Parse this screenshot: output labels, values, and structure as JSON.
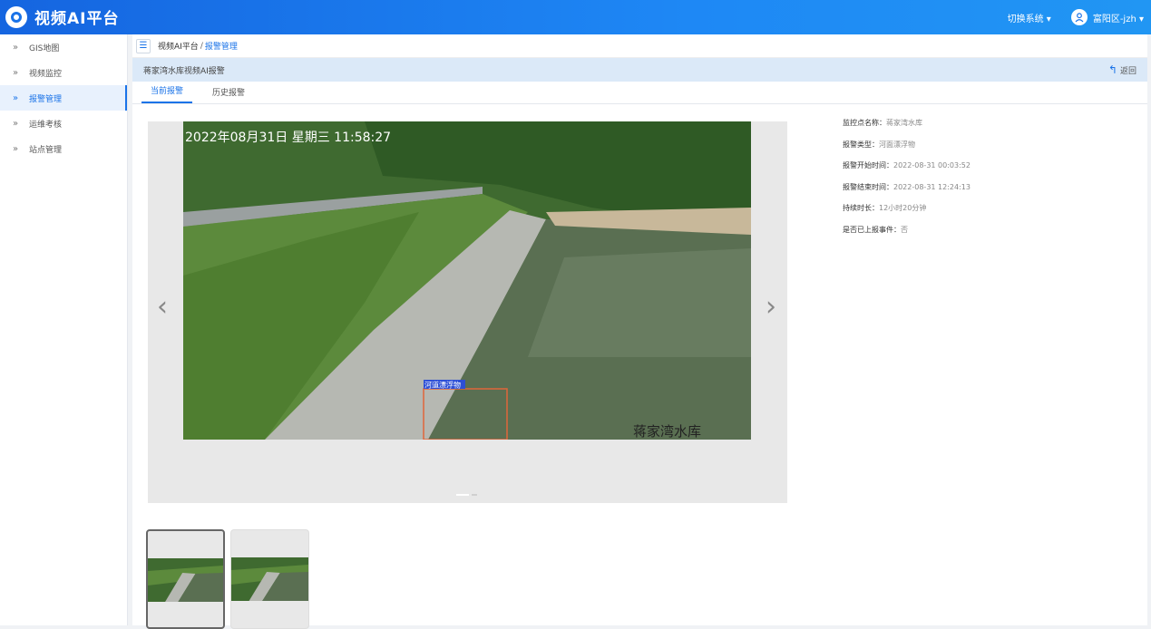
{
  "header": {
    "app_title": "视频AI平台",
    "switch_system": "切换系统 ▾",
    "user": "富阳区-jzh ▾"
  },
  "sidebar": {
    "items": [
      {
        "label": "GIS地图",
        "icon": "double-chevron-right-icon"
      },
      {
        "label": "视频监控",
        "icon": "double-chevron-right-icon"
      },
      {
        "label": "报警管理",
        "icon": "double-chevron-right-icon",
        "active": true
      },
      {
        "label": "运维考核",
        "icon": "double-chevron-right-icon"
      },
      {
        "label": "站点管理",
        "icon": "double-chevron-right-icon"
      }
    ]
  },
  "breadcrumb": {
    "root": "视频AI平台",
    "sep": "/",
    "current": "报警管理"
  },
  "panel": {
    "title": "蒋家湾水库视频AI报警",
    "back_label": "返回"
  },
  "tabs": [
    {
      "label": "当前报警",
      "active": true
    },
    {
      "label": "历史报警",
      "active": false
    }
  ],
  "image": {
    "timestamp": "2022年08月31日  星期三  11:58:27",
    "detect_label": "河道漂浮物",
    "site_caption": "蒋家湾水库"
  },
  "details": [
    {
      "label": "监控点名称：",
      "value": "蒋家湾水库"
    },
    {
      "label": "报警类型：",
      "value": "河面漂浮物"
    },
    {
      "label": "报警开始时间：",
      "value": "2022-08-31 00:03:52"
    },
    {
      "label": "报警结束时间：",
      "value": "2022-08-31 12:24:13"
    },
    {
      "label": "持续时长：",
      "value": "12小时20分钟"
    },
    {
      "label": "是否已上报事件：",
      "value": "否"
    }
  ],
  "colors": {
    "primary": "#1a73e8",
    "topbar": "#1e88f5",
    "detect_box": "#e0663a"
  }
}
